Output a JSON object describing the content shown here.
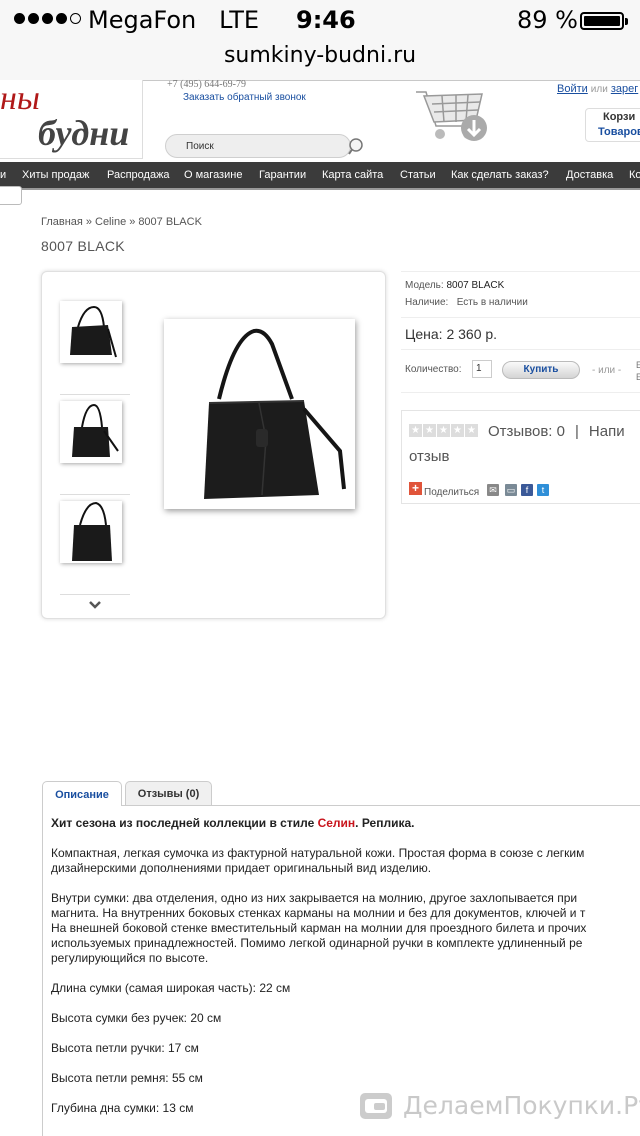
{
  "status_bar": {
    "carrier": "MegaFon",
    "network": "LTE",
    "time": "9:46",
    "battery": "89 %"
  },
  "browser": {
    "url": "sumkiny-budni.ru"
  },
  "header": {
    "logo_top": "ны",
    "logo_bottom": "будни",
    "phone": "+7 (495) 644-69-79",
    "callback": "Заказать обратный звонок",
    "search_placeholder": "Поиск",
    "login": "Войти",
    "or": "или",
    "register": "зарег",
    "cart_title": "Корзи",
    "cart_items": "Товаров"
  },
  "nav": {
    "items": [
      "и",
      "Хиты продаж",
      "Распродажа",
      "О магазине",
      "Гарантии",
      "Карта сайта",
      "Статьи",
      "Как сделать заказ?",
      "Доставка",
      "Ко"
    ]
  },
  "breadcrumb": {
    "home": "Главная",
    "sep": "»",
    "brand": "Celine",
    "current": "8007 BLACK"
  },
  "product": {
    "title": "8007 BLACK",
    "model_label": "Модель:",
    "model_value": "8007 BLACK",
    "stock_label": "Наличие:",
    "stock_value": "Есть в наличии",
    "price": "Цена: 2 360 р.",
    "qty_label": "Количество:",
    "qty_value": "1",
    "buy_label": "Купить",
    "or_label": "- или -",
    "cut_letter": "Е",
    "reviews_count": "Отзывов: 0",
    "reviews_sep": "|",
    "write_review_1": "Напи",
    "write_review_2": "отзыв",
    "share_label": "Поделиться"
  },
  "tabs": {
    "description": "Описание",
    "reviews": "Отзывы (0)"
  },
  "description": {
    "headline_pre": "Хит сезона из последней коллекции в стиле ",
    "headline_brand": "Селин",
    "headline_post": ". Реплика.",
    "para1_l1": "Компактная, легкая сумочка из фактурной натуральной кожи. Простая форма в союзе с легким",
    "para1_l2": "дизайнерскими дополнениями придает оригинальный вид изделию.",
    "para2_l1": "Внутри сумки: два отделения, одно из них закрывается на молнию, другое захлопывается при",
    "para2_l2": "магнита. На внутренних боковых стенках карманы на молнии и без для документов, ключей и т",
    "para2_l3": "На внешней боковой стенке вместительный карман на молнии для проездного билета и прочих",
    "para2_l4": "используемых принадлежностей. Помимо легкой одинарной ручки в комплекте удлиненный ре",
    "para2_l5": "регулирующийся по высоте.",
    "length": "Длина сумки (самая широкая часть): 22 см",
    "height": "Высота сумки без ручек: 20 см",
    "handle": "Высота петли ручки: 17 см",
    "strap": "Высота петли ремня: 55 см",
    "depth": "Глубина дна сумки: 13 см"
  },
  "watermark": {
    "text": "ДелаемПокупки.Ру"
  },
  "colors": {
    "nav_bg": "#3b3b3b",
    "link_blue": "#1a4fa0",
    "brand_red": "#c8141c"
  }
}
